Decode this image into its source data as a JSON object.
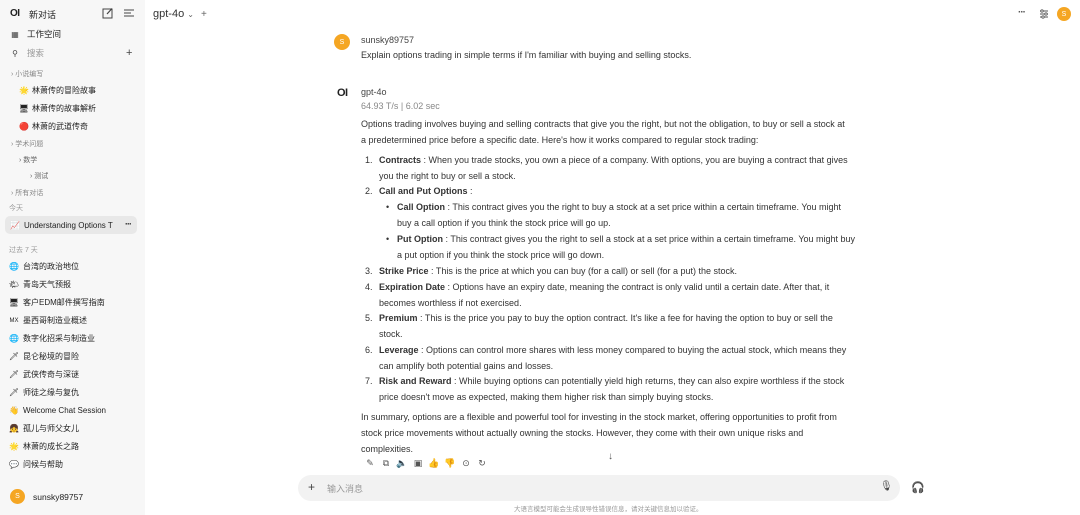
{
  "sidebar": {
    "logo": "OI",
    "new_chat": "新对话",
    "workspace": "工作空间",
    "search_placeholder": "搜索",
    "folders": [
      {
        "name": "小说编写",
        "items": [
          {
            "icon": "🌟",
            "label": "林萧传的冒险故事"
          },
          {
            "icon": "🖥",
            "label": "林萧传的故事解析"
          },
          {
            "icon": "🔴",
            "label": "林萧的武道传奇"
          }
        ]
      },
      {
        "name": "学术问题",
        "sub": "数学",
        "subsub": "测试"
      },
      {
        "name": "所有对话"
      }
    ],
    "today_label": "今天",
    "active_chat": {
      "icon": "📈",
      "label": "Understanding Options T"
    },
    "past7_label": "过去 7 天",
    "chats": [
      {
        "icon": "🌐",
        "label": "台湾的政治地位"
      },
      {
        "icon": "🌤",
        "label": "青岛天气预报"
      },
      {
        "icon": "🖥",
        "label": "客户EDM邮件撰写指南"
      },
      {
        "icon": "MX",
        "label": "墨西哥制造业概述"
      },
      {
        "icon": "🌐",
        "label": "数字化招采与制造业"
      },
      {
        "icon": "🗡",
        "label": "昆仑秘境的冒险"
      },
      {
        "icon": "🗡",
        "label": "武侠传奇与深谜"
      },
      {
        "icon": "🗡",
        "label": "师徒之缘与复仇"
      },
      {
        "icon": "👋",
        "label": "Welcome Chat Session"
      },
      {
        "icon": "👧",
        "label": "孤儿与师父女儿"
      },
      {
        "icon": "🌟",
        "label": "林萧的成长之路"
      },
      {
        "icon": "💬",
        "label": "问候与帮助"
      }
    ],
    "user": {
      "initial": "S",
      "name": "sunsky89757"
    }
  },
  "header": {
    "model": "gpt-4o"
  },
  "conversation": {
    "user_message": {
      "sender": "sunsky89757",
      "initial": "S",
      "text": "Explain options trading in simple terms if I'm familiar with buying and selling stocks."
    },
    "ai_message": {
      "sender": "gpt-4o",
      "stats": "64.93 T/s | 6.02 sec",
      "intro_1": "Options trading involves buying and selling contracts that give you the right, but not the obligation, to buy or sell a stock at",
      "intro_2": "a predetermined price before a specific date. Here's how it works compared to regular stock trading:",
      "items": [
        {
          "num": "1.",
          "title": "Contracts",
          "l1": ": When you trade stocks, you own a piece of a company. With options, you are buying a contract that gives",
          "l2": "you the right to buy or sell a stock."
        },
        {
          "num": "2.",
          "title": "Call and Put Options",
          "l1": ":",
          "l2": ""
        },
        {
          "num": "3.",
          "title": "Strike Price",
          "l1": ": This is the price at which you can buy (for a call) or sell (for a put) the stock.",
          "l2": ""
        },
        {
          "num": "4.",
          "title": "Expiration Date",
          "l1": ": Options have an expiry date, meaning the contract is only valid until a certain date. After that, it",
          "l2": "becomes worthless if not exercised."
        },
        {
          "num": "5.",
          "title": "Premium",
          "l1": ": This is the price you pay to buy the option contract. It's like a fee for having the option to buy or sell the",
          "l2": "stock."
        },
        {
          "num": "6.",
          "title": "Leverage",
          "l1": ": Options can control more shares with less money compared to buying the actual stock, which means they",
          "l2": "can amplify both potential gains and losses."
        },
        {
          "num": "7.",
          "title": "Risk and Reward",
          "l1": ": While buying options can potentially yield high returns, they can also expire worthless if the stock",
          "l2": "price doesn't move as expected, making them higher risk than simply buying stocks."
        }
      ],
      "sub_items": [
        {
          "title": "Call Option",
          "l1": ": This contract gives you the right to buy a stock at a set price within a certain timeframe. You might",
          "l2": "buy a call option if you think the stock price will go up."
        },
        {
          "title": "Put Option",
          "l1": ": This contract gives you the right to sell a stock at a set price within a certain timeframe. You might buy",
          "l2": "a put option if you think the stock price will go down."
        }
      ],
      "summary_1": "In summary, options are a flexible and powerful tool for investing in the stock market, offering opportunities to profit from",
      "summary_2": "stock price movements without actually owning the stocks. However, they come with their own unique risks and",
      "summary_3": "complexities."
    }
  },
  "input": {
    "placeholder": "输入消息"
  },
  "disclaimer": "大语言模型可能会生成误导性错误信息，请对关键信息加以验证。"
}
